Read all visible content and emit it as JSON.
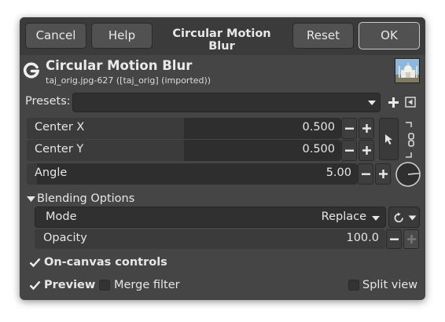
{
  "header": {
    "cancel_label": "Cancel",
    "help_label": "Help",
    "title": "Circular Motion Blur",
    "reset_label": "Reset",
    "ok_label": "OK"
  },
  "tool": {
    "title": "Circular Motion Blur",
    "subtitle": "taj_orig.jpg-627 ([taj_orig] (imported))"
  },
  "presets": {
    "label": "Presets:",
    "value": ""
  },
  "params": {
    "center_x": {
      "label": "Center X",
      "value": "0.500",
      "fraction": 0.5
    },
    "center_y": {
      "label": "Center Y",
      "value": "0.500",
      "fraction": 0.5
    },
    "angle": {
      "label": "Angle",
      "value": "5.00",
      "fraction": 0.03
    }
  },
  "blending": {
    "section_label": "Blending Options",
    "mode_label": "Mode",
    "mode_value": "Replace",
    "opacity_label": "Opacity",
    "opacity_value": "100.0",
    "opacity_fraction": 1.0
  },
  "options": {
    "on_canvas_label": "On-canvas controls",
    "on_canvas_checked": true,
    "preview_label": "Preview",
    "preview_checked": true,
    "merge_label": "Merge filter",
    "merge_checked": false,
    "split_label": "Split view",
    "split_checked": false
  },
  "icons": {
    "logo": "gegl-g-logo",
    "thumbnail": "taj-mahal-thumbnail",
    "dropdown": "chevron-down-icon",
    "add": "plus-icon",
    "presets_menu": "menu-square-icon",
    "pointer": "arrow-pointer-icon",
    "chain": "chain-link-icon",
    "dial": "angle-dial-icon",
    "reset_mode": "rotate-reset-icon",
    "check": "checkmark-icon"
  }
}
